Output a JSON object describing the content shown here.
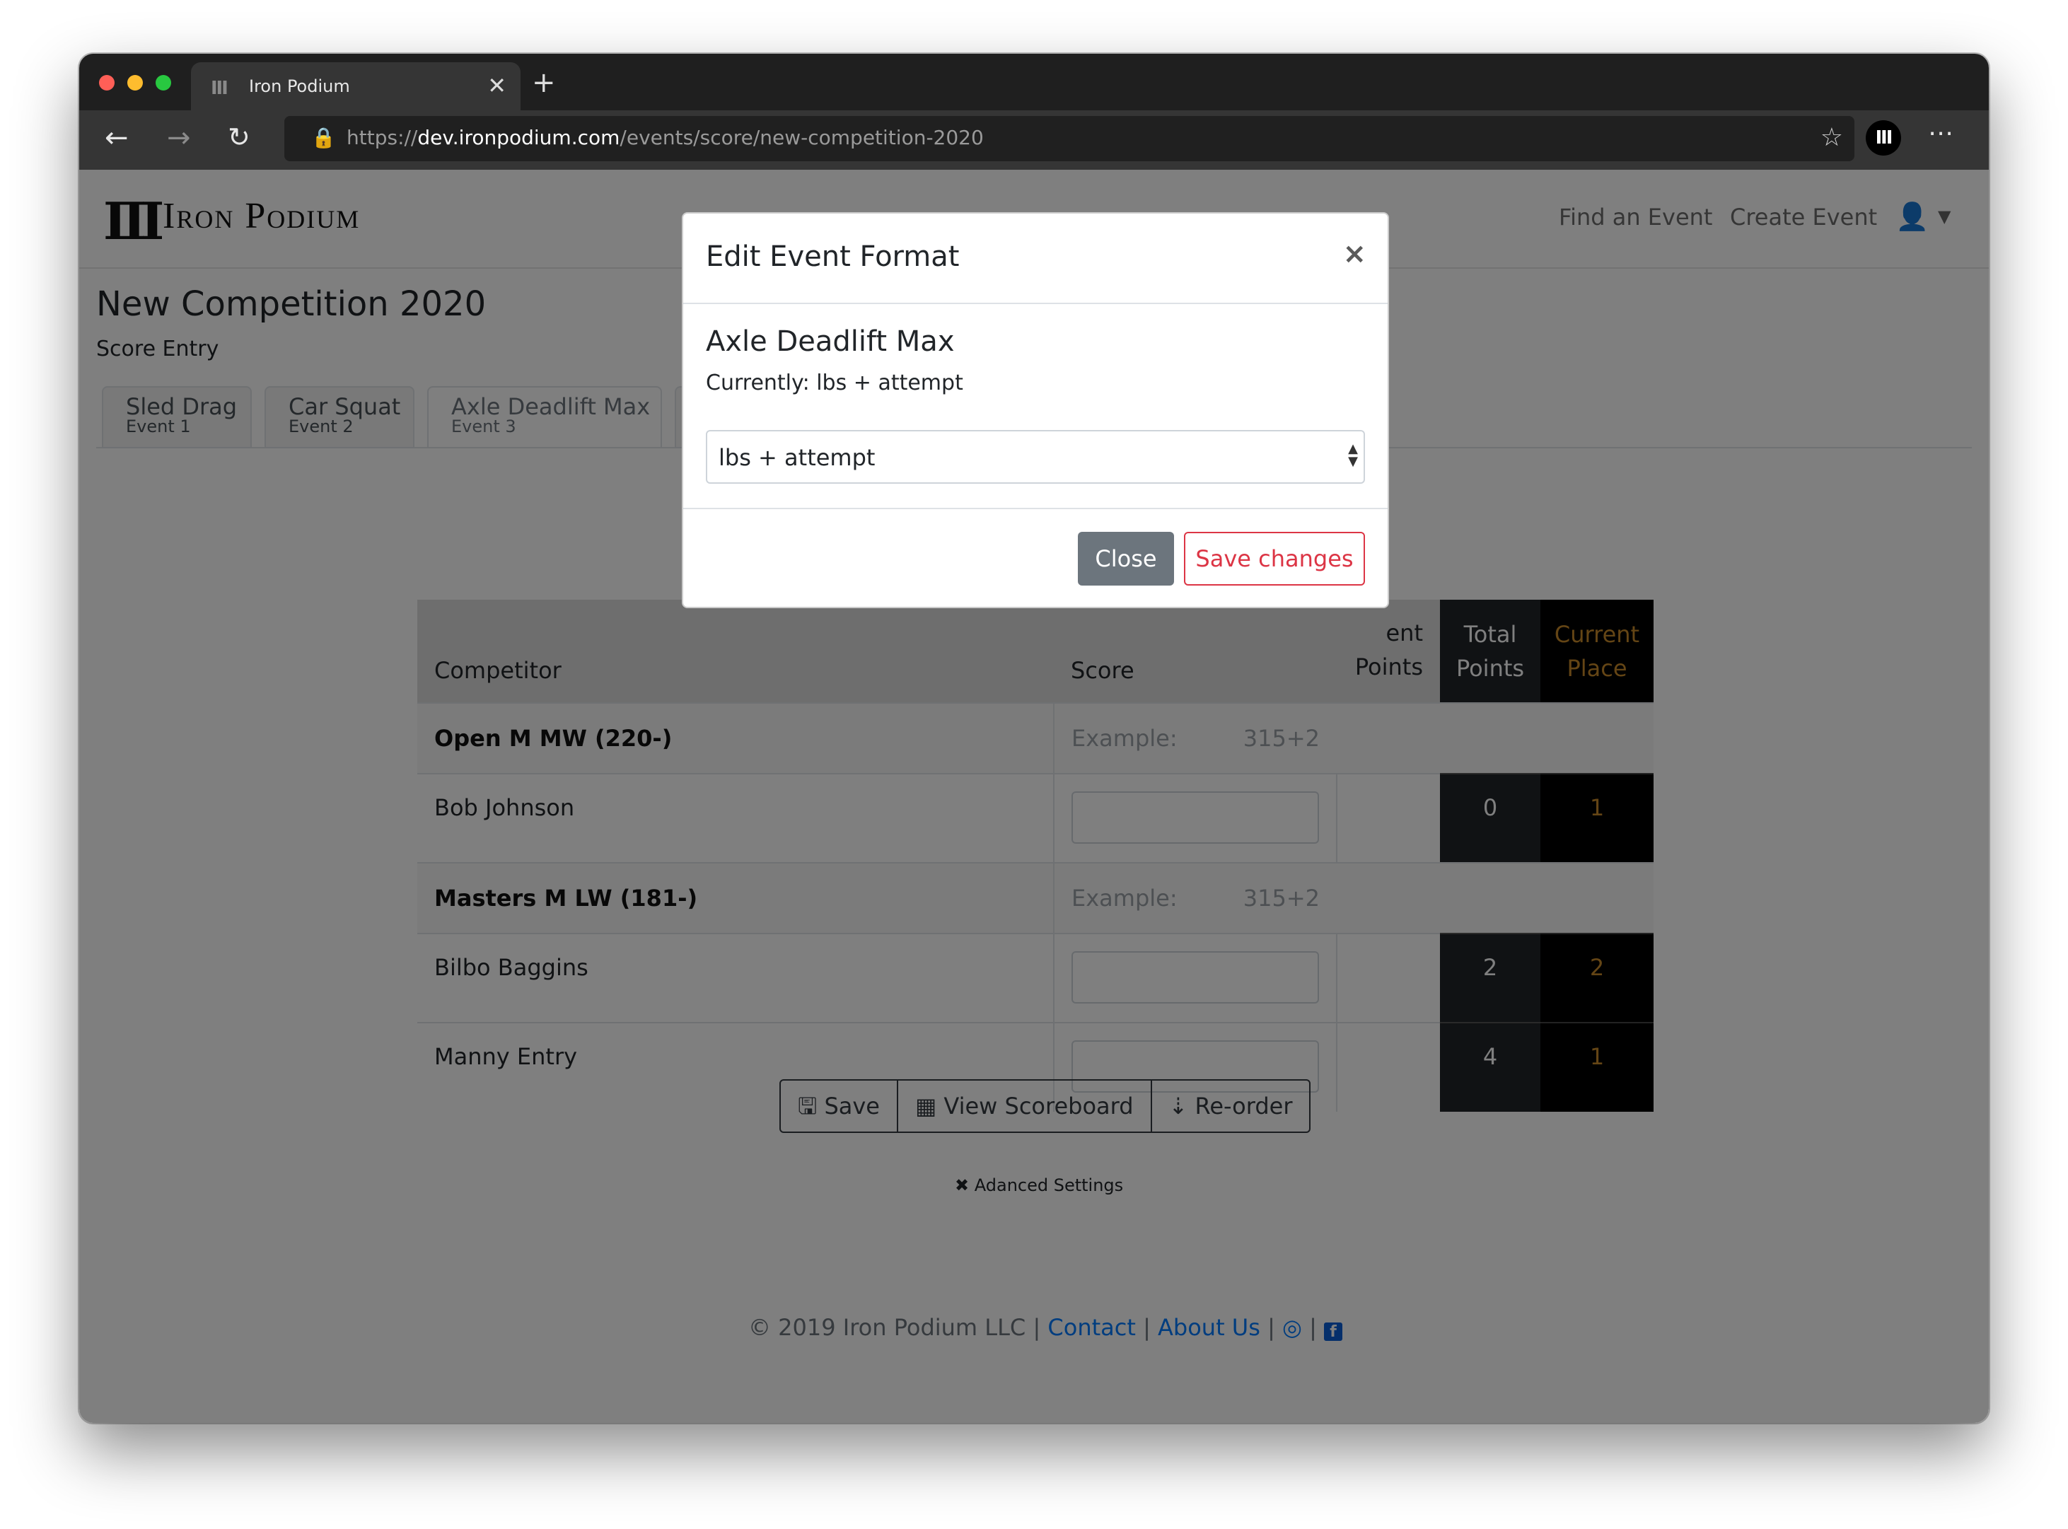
{
  "browser": {
    "tab_title": "Iron Podium",
    "tab_favicon": "ⅡⅠ",
    "url_scheme": "https://",
    "url_host": "dev.ironpodium.com",
    "url_path": "/events/score/new-competition-2020",
    "profile_initials": "ⅡⅠ",
    "traffic_light_colors": [
      "#ff5f57",
      "#febc2e",
      "#28c840"
    ]
  },
  "header": {
    "logo_mark": "ⅡⅠ",
    "logo_text": "Iron Podium",
    "nav": [
      "Find an Event",
      "Create Event"
    ],
    "user_icon": "user-cog-icon"
  },
  "page": {
    "title": "New Competition 2020",
    "subtitle": "Score Entry"
  },
  "event_tabs": [
    {
      "name": "Sled Drag",
      "sub": "Event 1"
    },
    {
      "name": "Car Squat",
      "sub": "Event 2"
    },
    {
      "name": "Axle Deadlift Max",
      "sub": "Event 3",
      "active": true
    }
  ],
  "table": {
    "headers": {
      "competitor": "Competitor",
      "score": "Score",
      "event_points": "Event Points",
      "event_points_visible": "ent",
      "points": "Points",
      "total_points_1": "Total",
      "total_points_2": "Points",
      "current_place_1": "Current",
      "current_place_2": "Place"
    },
    "groups": [
      {
        "name": "Open M MW (220-)",
        "example_label": "Example:",
        "example_value": "315+2",
        "rows": [
          {
            "name": "Bob Johnson",
            "total": "0",
            "place": "1"
          }
        ]
      },
      {
        "name": "Masters M LW (181-)",
        "example_label": "Example:",
        "example_value": "315+2",
        "rows": [
          {
            "name": "Bilbo Baggins",
            "total": "2",
            "place": "2"
          },
          {
            "name": "Manny Entry",
            "total": "4",
            "place": "1"
          }
        ]
      }
    ]
  },
  "actions": {
    "save": "Save",
    "view_scoreboard": "View Scoreboard",
    "reorder": "Re-order",
    "advanced": "Adanced Settings"
  },
  "footer": {
    "copyright": "© 2019 Iron Podium LLC",
    "sep": "|",
    "contact": "Contact",
    "about": "About Us"
  },
  "modal": {
    "title": "Edit Event Format",
    "event_name": "Axle Deadlift Max",
    "currently": "Currently: lbs + attempt",
    "select_value": "lbs + attempt",
    "close": "Close",
    "save": "Save changes"
  },
  "colors": {
    "place_accent": "#c98a2a",
    "link": "#007bff",
    "danger": "#dc3545"
  }
}
